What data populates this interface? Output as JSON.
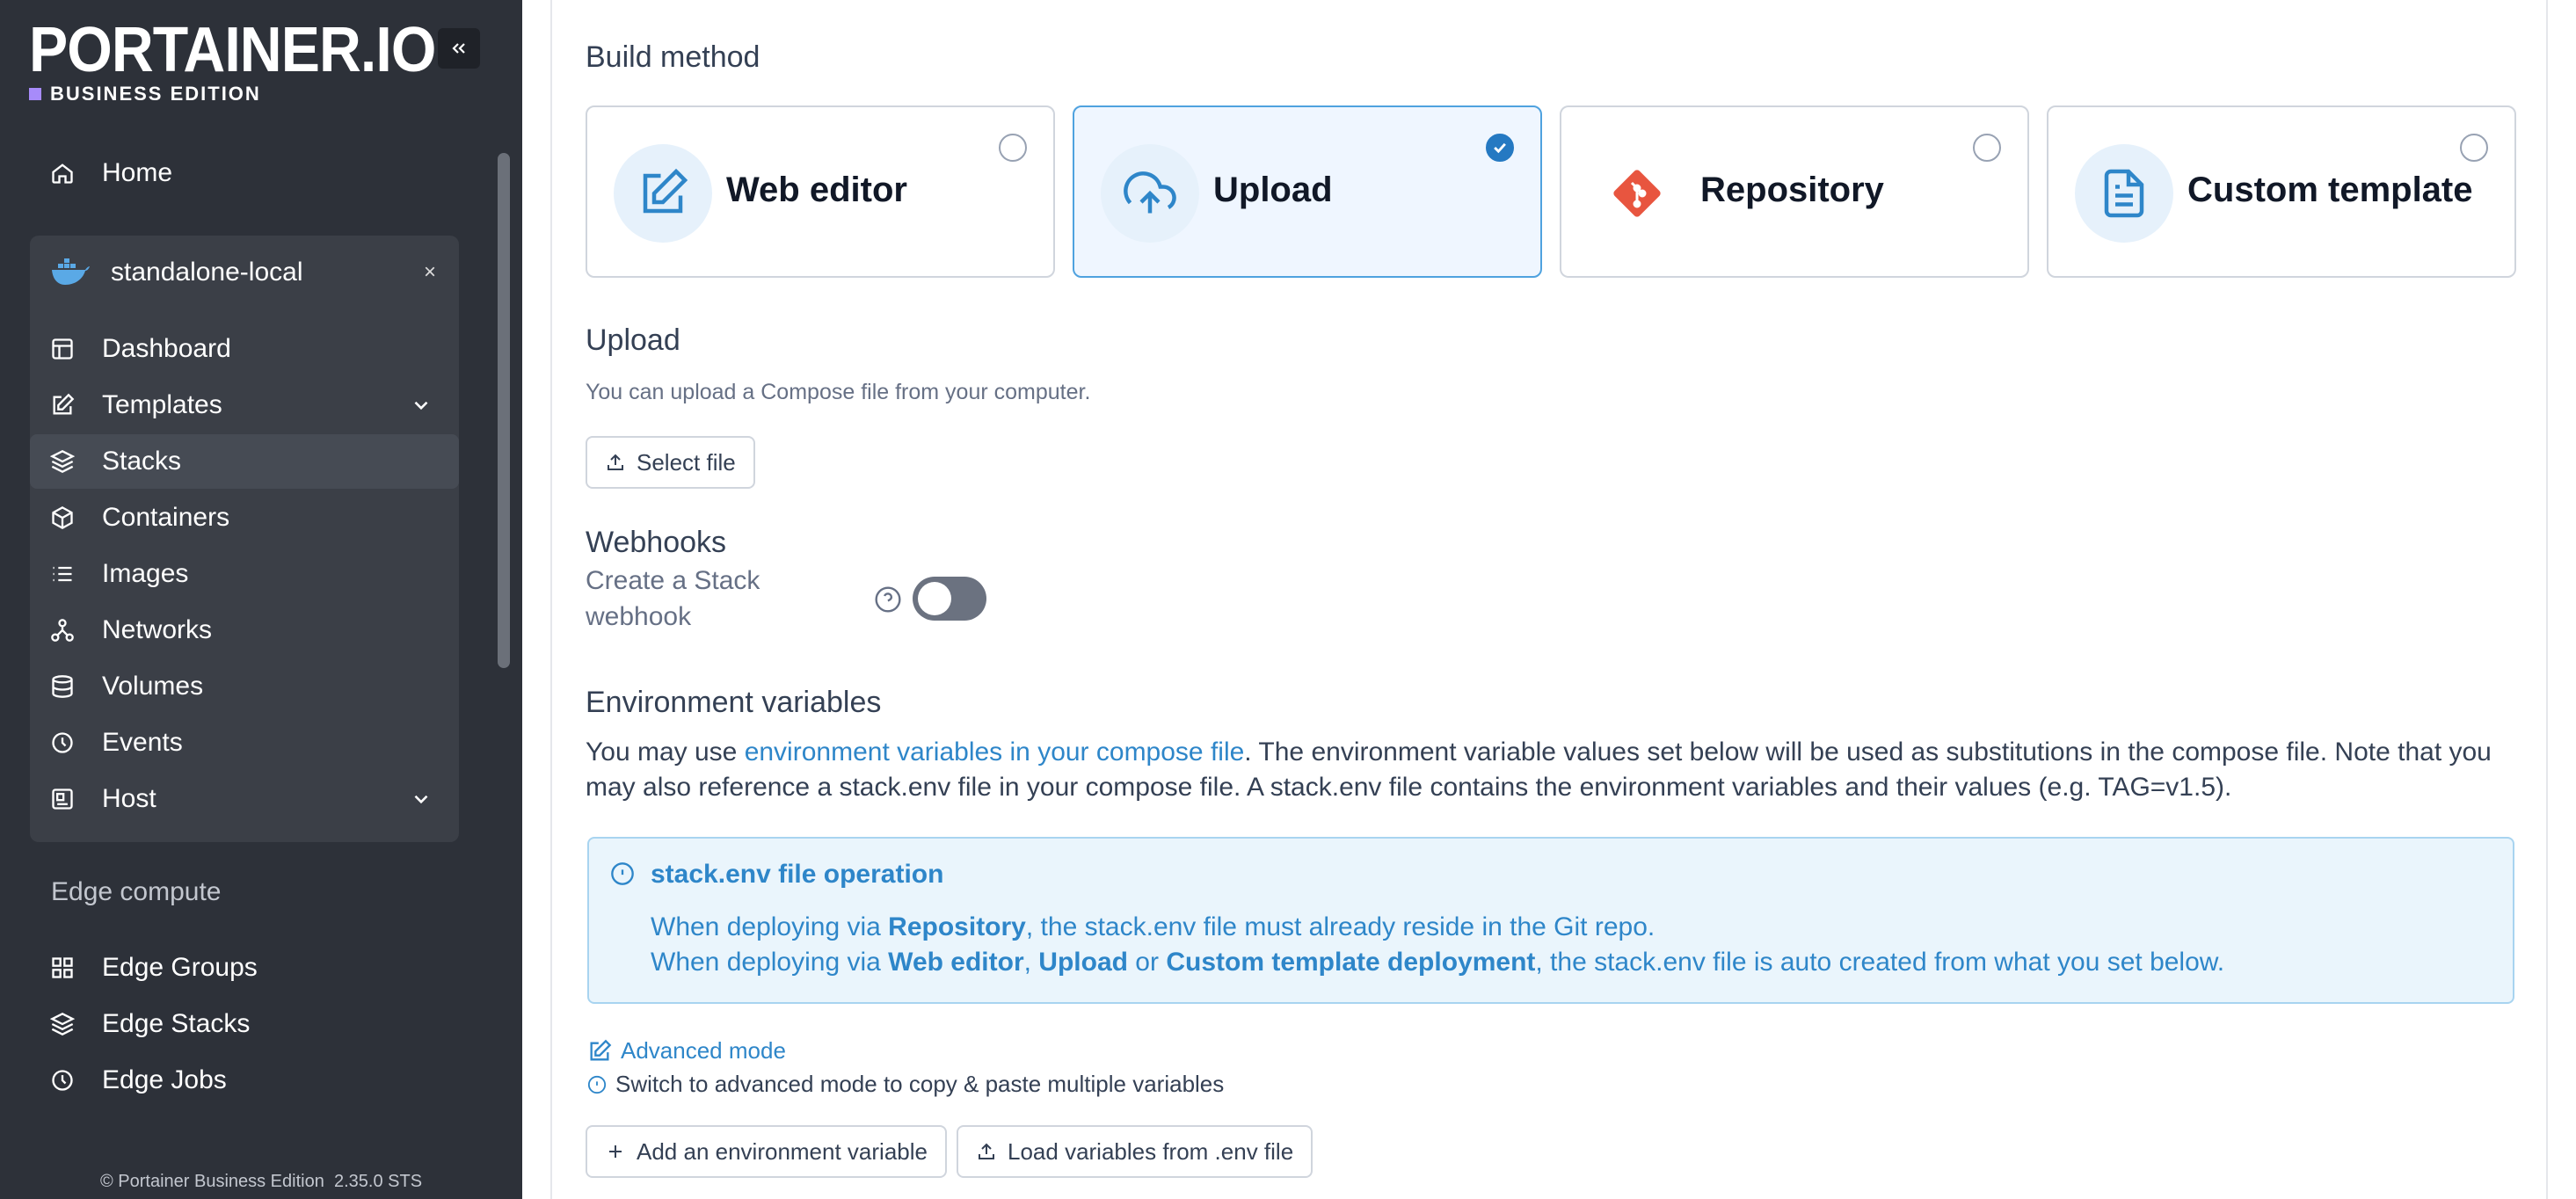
{
  "brand": {
    "name": "PORTAINER.IO",
    "edition": "BUSINESS EDITION"
  },
  "sidebar": {
    "home": "Home",
    "environment": {
      "name": "standalone-local",
      "close": "×"
    },
    "items": [
      {
        "label": "Dashboard",
        "icon": "dashboard-icon"
      },
      {
        "label": "Templates",
        "icon": "edit-icon"
      },
      {
        "label": "Stacks",
        "icon": "layers-icon"
      },
      {
        "label": "Containers",
        "icon": "box-icon"
      },
      {
        "label": "Images",
        "icon": "list-icon"
      },
      {
        "label": "Networks",
        "icon": "network-icon"
      },
      {
        "label": "Volumes",
        "icon": "database-icon"
      },
      {
        "label": "Events",
        "icon": "clock-icon"
      },
      {
        "label": "Host",
        "icon": "host-icon"
      }
    ],
    "edge_section": "Edge compute",
    "edge_items": [
      {
        "label": "Edge Groups",
        "icon": "grid-icon"
      },
      {
        "label": "Edge Stacks",
        "icon": "layers-icon"
      },
      {
        "label": "Edge Jobs",
        "icon": "clock-icon"
      }
    ],
    "footer": {
      "product": "Portainer Business Edition",
      "version": "2.35.0 STS",
      "copyright": "©"
    }
  },
  "build": {
    "title": "Build method",
    "methods": [
      {
        "label": "Web editor",
        "selected": false
      },
      {
        "label": "Upload",
        "selected": true
      },
      {
        "label": "Repository",
        "selected": false
      },
      {
        "label": "Custom template",
        "selected": false
      }
    ]
  },
  "upload": {
    "title": "Upload",
    "description": "You can upload a Compose file from your computer.",
    "select_button": "Select file"
  },
  "webhooks": {
    "title": "Webhooks",
    "label_line1": "Create a Stack",
    "label_line2": "webhook",
    "enabled": false
  },
  "env": {
    "title": "Environment variables",
    "text_before": "You may use ",
    "link": "environment variables in your compose file",
    "text_after": ". The environment variable values set below will be used as substitutions in the compose file. Note that you may also reference a stack.env file in your compose file. A stack.env file contains the environment variables and their values (e.g. TAG=v1.5).",
    "info": {
      "title": "stack.env file operation",
      "l1_pre": "When deploying via ",
      "l1_b": "Repository",
      "l1_post": ", the stack.env file must already reside in the Git repo.",
      "l2_pre": "When deploying via ",
      "l2_b1": "Web editor",
      "l2_sep1": ", ",
      "l2_b2": "Upload",
      "l2_sep2": " or ",
      "l2_b3": "Custom template deployment",
      "l2_post": ", the stack.env file is auto created from what you set below."
    },
    "advanced_mode": "Advanced mode",
    "advanced_hint": "Switch to advanced mode to copy & paste multiple variables",
    "add_button": "Add an environment variable",
    "load_button": "Load variables from .env file"
  },
  "colors": {
    "sidebar_bg": "#2d3139",
    "accent": "#2e86c9",
    "selected_card": "#eff6ff"
  }
}
